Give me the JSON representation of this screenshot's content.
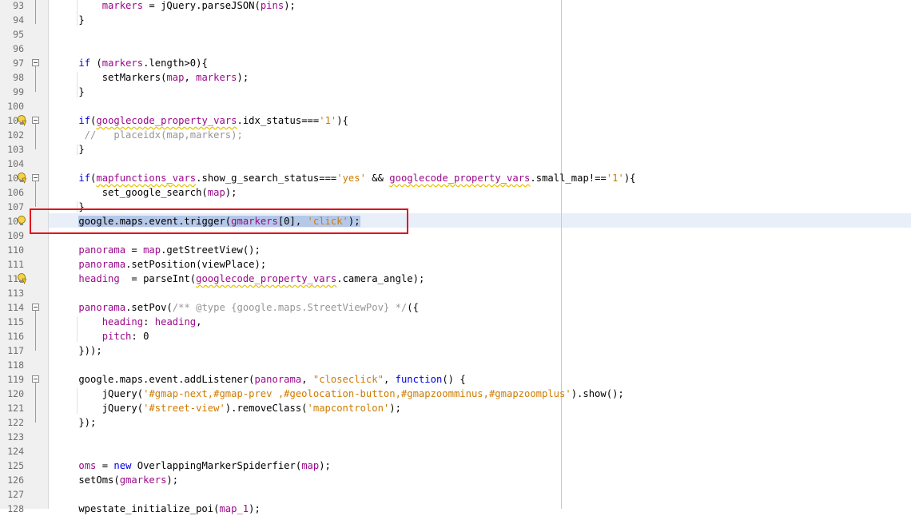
{
  "editor": {
    "colors": {
      "keyword": "#0000e6",
      "variable": "#9a0a8a",
      "string": "#ce7b00",
      "comment": "#969696"
    },
    "lines": [
      {
        "n": "93",
        "text": "        markers = jQuery.parseJSON(pins);"
      },
      {
        "n": "94",
        "text": "    }"
      },
      {
        "n": "95",
        "text": ""
      },
      {
        "n": "96",
        "text": ""
      },
      {
        "n": "97",
        "text": "    if (markers.length>0){"
      },
      {
        "n": "98",
        "text": "        setMarkers(map, markers);"
      },
      {
        "n": "99",
        "text": "    }"
      },
      {
        "n": "100",
        "text": ""
      },
      {
        "n": "101",
        "text": "    if(googlecode_property_vars.idx_status==='1'){"
      },
      {
        "n": "102",
        "text": "     //   placeidx(map,markers);"
      },
      {
        "n": "103",
        "text": "    }"
      },
      {
        "n": "104",
        "text": ""
      },
      {
        "n": "105",
        "text": "    if(mapfunctions_vars.show_g_search_status==='yes' && googlecode_property_vars.small_map!=='1'){"
      },
      {
        "n": "106",
        "text": "        set_google_search(map);"
      },
      {
        "n": "107",
        "text": "    }"
      },
      {
        "n": "108",
        "text": "    google.maps.event.trigger(gmarkers[0], 'click');"
      },
      {
        "n": "109",
        "text": ""
      },
      {
        "n": "110",
        "text": "    panorama = map.getStreetView();"
      },
      {
        "n": "111",
        "text": "    panorama.setPosition(viewPlace);"
      },
      {
        "n": "112",
        "text": "    heading  = parseInt(googlecode_property_vars.camera_angle);"
      },
      {
        "n": "113",
        "text": ""
      },
      {
        "n": "114",
        "text": "    panorama.setPov(/** @type {google.maps.StreetViewPov} */({"
      },
      {
        "n": "115",
        "text": "        heading: heading,"
      },
      {
        "n": "116",
        "text": "        pitch: 0"
      },
      {
        "n": "117",
        "text": "    }));"
      },
      {
        "n": "118",
        "text": ""
      },
      {
        "n": "119",
        "text": "    google.maps.event.addListener(panorama, \"closeclick\", function() {"
      },
      {
        "n": "120",
        "text": "        jQuery('#gmap-next,#gmap-prev ,#geolocation-button,#gmapzoomminus,#gmapzoomplus').show();"
      },
      {
        "n": "121",
        "text": "        jQuery('#street-view').removeClass('mapcontrolon');"
      },
      {
        "n": "122",
        "text": "    });"
      },
      {
        "n": "123",
        "text": ""
      },
      {
        "n": "124",
        "text": ""
      },
      {
        "n": "125",
        "text": "    oms = new OverlappingMarkerSpiderfier(map);"
      },
      {
        "n": "126",
        "text": "    setOms(gmarkers);"
      },
      {
        "n": "127",
        "text": ""
      },
      {
        "n": "128",
        "text": "    wpestate_initialize_poi(map_1);"
      }
    ]
  }
}
